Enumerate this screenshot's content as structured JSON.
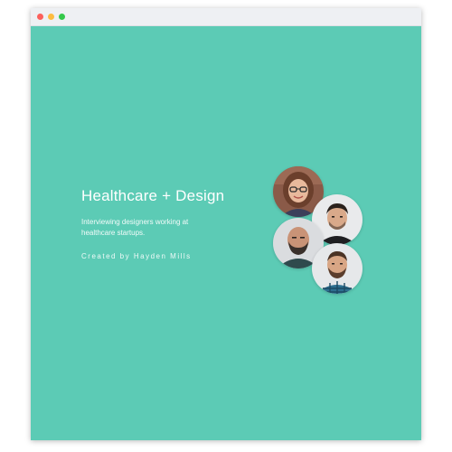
{
  "window": {
    "controls": [
      {
        "name": "close",
        "color": "#fc605c"
      },
      {
        "name": "minimize",
        "color": "#fdbc40"
      },
      {
        "name": "maximize",
        "color": "#34c84a"
      }
    ]
  },
  "page": {
    "background_color": "#5ccbb5",
    "title": "Healthcare + Design",
    "subtitle": "Interviewing designers working at healthcare startups.",
    "credit": "Created by Hayden Mills"
  },
  "avatars": [
    {
      "name": "designer-avatar-woman-glasses"
    },
    {
      "name": "designer-avatar-man-dark-hair"
    },
    {
      "name": "designer-avatar-man-bald-beard"
    },
    {
      "name": "designer-avatar-man-plaid-shirt"
    }
  ]
}
